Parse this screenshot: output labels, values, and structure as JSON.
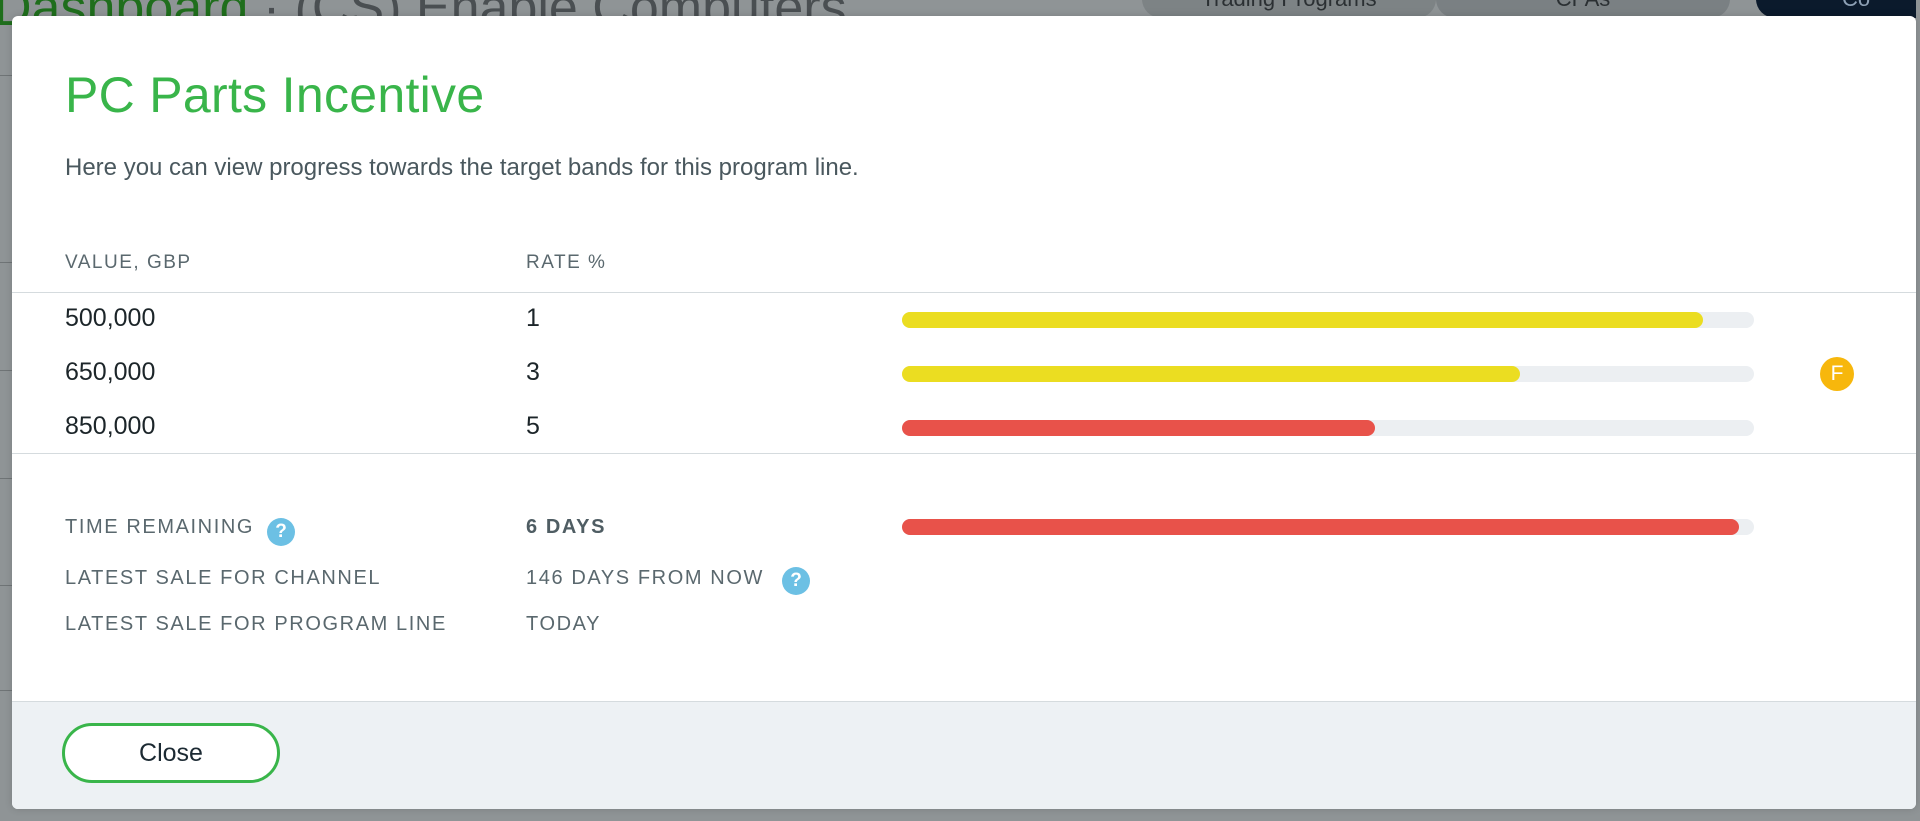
{
  "background": {
    "title_green": "Dashboard",
    "title_rest": " · (CS) Enable Computers",
    "tabs": [
      "Trading Programs",
      "CPAs",
      "Co"
    ]
  },
  "modal": {
    "title": "PC Parts Incentive",
    "description": "Here you can view progress towards the target bands for this program line.",
    "columns": {
      "value": "VALUE, GBP",
      "rate": "RATE %"
    },
    "bands": [
      {
        "value": "500,000",
        "rate": "1",
        "progress": 0.94,
        "color": "#ebdd21",
        "badge": ""
      },
      {
        "value": "650,000",
        "rate": "3",
        "progress": 0.725,
        "color": "#ebdd21",
        "badge": "F"
      },
      {
        "value": "850,000",
        "rate": "5",
        "progress": 0.555,
        "color": "#e8524a",
        "badge": ""
      }
    ],
    "info": {
      "time_remaining_label": "TIME REMAINING",
      "time_remaining_value": "6 DAYS",
      "time_remaining_progress": 0.982,
      "time_remaining_color": "#e8524a",
      "latest_channel_label": "LATEST SALE FOR CHANNEL",
      "latest_channel_value": "146 DAYS FROM NOW",
      "latest_line_label": "LATEST SALE FOR PROGRAM LINE",
      "latest_line_value": "TODAY",
      "help_glyph": "?"
    },
    "footer": {
      "close_label": "Close"
    }
  },
  "colors": {
    "accent_green": "#39b54a",
    "help_blue": "#6cc0e4",
    "badge_amber": "#f7b70c"
  },
  "icons": {
    "help": "help-icon",
    "badge": "band-achieved-badge"
  }
}
